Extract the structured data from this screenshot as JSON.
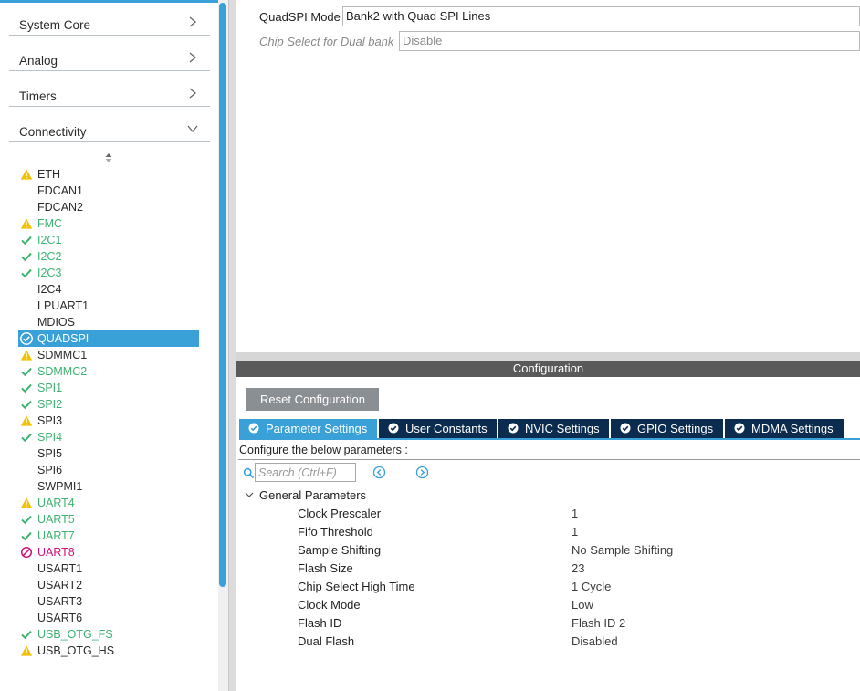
{
  "sidebar": {
    "categories": [
      {
        "label": "System Core",
        "expanded": false
      },
      {
        "label": "Analog",
        "expanded": false
      },
      {
        "label": "Timers",
        "expanded": false
      },
      {
        "label": "Connectivity",
        "expanded": true
      }
    ],
    "peripherals": [
      {
        "label": "ETH",
        "status": "warning"
      },
      {
        "label": "FDCAN1",
        "status": "none"
      },
      {
        "label": "FDCAN2",
        "status": "none"
      },
      {
        "label": "FMC",
        "status": "warning-green"
      },
      {
        "label": "I2C1",
        "status": "ok"
      },
      {
        "label": "I2C2",
        "status": "ok"
      },
      {
        "label": "I2C3",
        "status": "ok"
      },
      {
        "label": "I2C4",
        "status": "none"
      },
      {
        "label": "LPUART1",
        "status": "none"
      },
      {
        "label": "MDIOS",
        "status": "none"
      },
      {
        "label": "QUADSPI",
        "status": "selected"
      },
      {
        "label": "SDMMC1",
        "status": "warning"
      },
      {
        "label": "SDMMC2",
        "status": "ok"
      },
      {
        "label": "SPI1",
        "status": "ok"
      },
      {
        "label": "SPI2",
        "status": "ok"
      },
      {
        "label": "SPI3",
        "status": "warning"
      },
      {
        "label": "SPI4",
        "status": "ok"
      },
      {
        "label": "SPI5",
        "status": "none"
      },
      {
        "label": "SPI6",
        "status": "none"
      },
      {
        "label": "SWPMI1",
        "status": "none"
      },
      {
        "label": "UART4",
        "status": "warning-green"
      },
      {
        "label": "UART5",
        "status": "ok"
      },
      {
        "label": "UART7",
        "status": "ok"
      },
      {
        "label": "UART8",
        "status": "error"
      },
      {
        "label": "USART1",
        "status": "none"
      },
      {
        "label": "USART2",
        "status": "none"
      },
      {
        "label": "USART3",
        "status": "none"
      },
      {
        "label": "USART6",
        "status": "none"
      },
      {
        "label": "USB_OTG_FS",
        "status": "ok"
      },
      {
        "label": "USB_OTG_HS",
        "status": "warning"
      }
    ]
  },
  "mode": {
    "quadspi_mode_label": "QuadSPI Mode",
    "quadspi_mode_value": "Bank2 with Quad SPI Lines",
    "chip_select_label": "Chip Select for Dual bank",
    "chip_select_value": "Disable"
  },
  "config": {
    "header": "Configuration",
    "reset_label": "Reset Configuration",
    "tabs": [
      {
        "label": "Parameter Settings",
        "active": true
      },
      {
        "label": "User Constants",
        "active": false
      },
      {
        "label": "NVIC Settings",
        "active": false
      },
      {
        "label": "GPIO Settings",
        "active": false
      },
      {
        "label": "MDMA Settings",
        "active": false
      }
    ],
    "configure_text": "Configure the below parameters :",
    "search_placeholder": "Search (Ctrl+F)",
    "group_label": "General Parameters",
    "params": [
      {
        "name": "Clock Prescaler",
        "value": "1"
      },
      {
        "name": "Fifo Threshold",
        "value": "1"
      },
      {
        "name": "Sample Shifting",
        "value": "No Sample Shifting"
      },
      {
        "name": "Flash Size",
        "value": "23"
      },
      {
        "name": "Chip Select High Time",
        "value": "1 Cycle"
      },
      {
        "name": "Clock Mode",
        "value": "Low"
      },
      {
        "name": "Flash ID",
        "value": "Flash ID 2"
      },
      {
        "name": "Dual Flash",
        "value": "Disabled"
      }
    ]
  },
  "colors": {
    "accent": "#3aa1d8",
    "tab_dark": "#0b2c4e",
    "ok_green": "#3cb371",
    "warning_yellow": "#f2c200",
    "error_magenta": "#d0117a"
  }
}
